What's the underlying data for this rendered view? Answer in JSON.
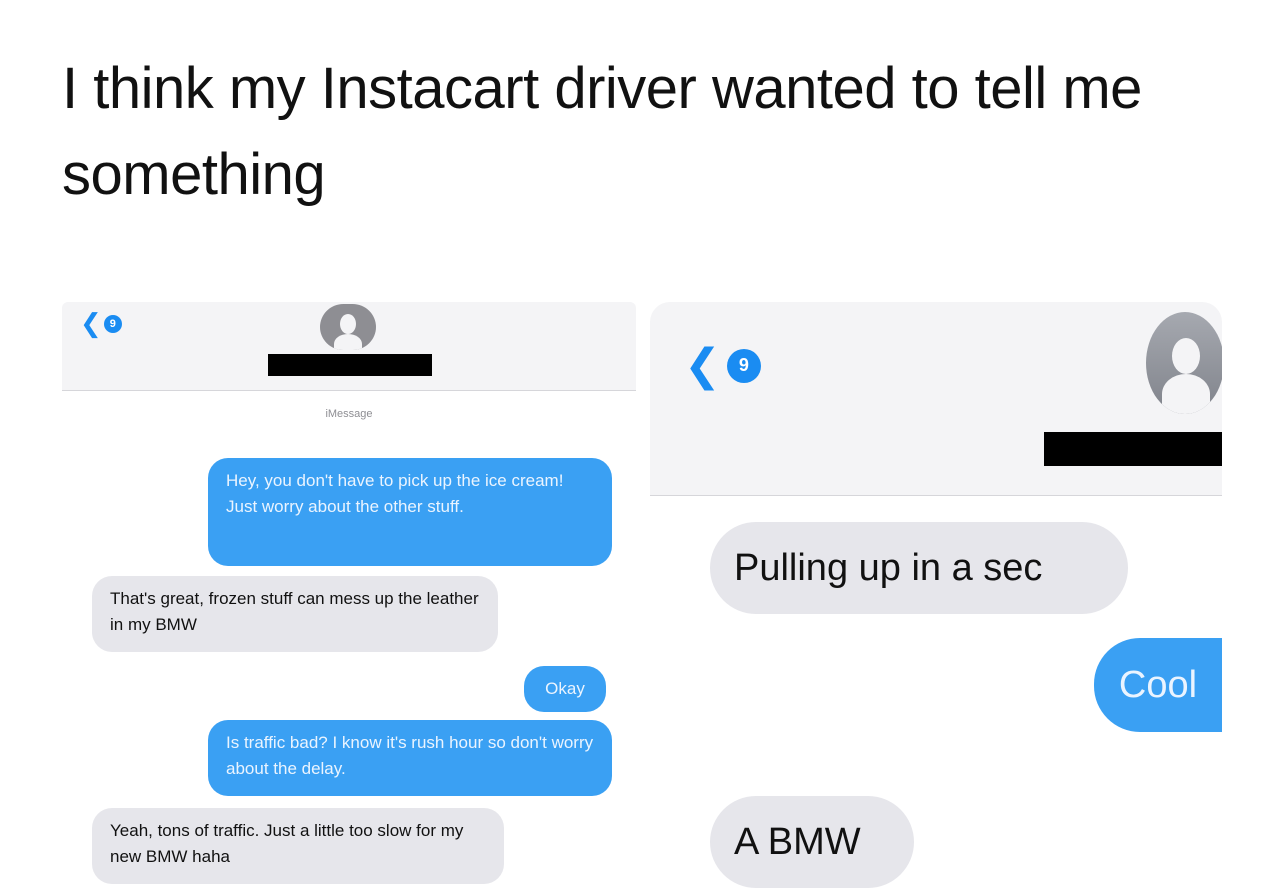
{
  "caption": "I think my Instacart driver wanted to tell me something",
  "left_screen": {
    "unread_count": "9",
    "service_label": "iMessage",
    "messages": [
      {
        "from": "me",
        "text": "Hey, you don't have to pick up the ice cream! Just worry about the other stuff."
      },
      {
        "from": "driver",
        "text": "That's great, frozen stuff can mess up the leather in my BMW"
      },
      {
        "from": "me",
        "text": "Okay"
      },
      {
        "from": "me",
        "text": "Is traffic bad? I know it's rush hour so don't worry about the delay."
      },
      {
        "from": "driver",
        "text": "Yeah, tons of traffic. Just a little too slow for my new BMW haha"
      }
    ]
  },
  "right_screen": {
    "unread_count": "9",
    "messages": [
      {
        "from": "driver",
        "text": "Pulling up in a sec"
      },
      {
        "from": "me",
        "text": "Cool"
      },
      {
        "from": "driver",
        "text": "A BMW"
      }
    ]
  },
  "colors": {
    "sent_bubble": "#3aa0f3",
    "received_bubble": "#e6e6eb",
    "accent": "#1a8cf2"
  },
  "icons": [
    "back-chevron-icon",
    "contact-avatar-icon"
  ]
}
